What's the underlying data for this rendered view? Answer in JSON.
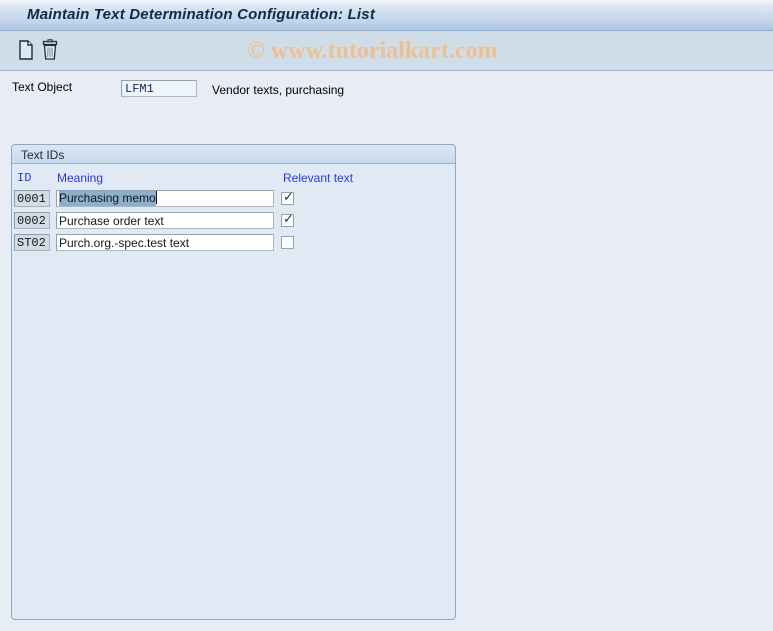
{
  "window": {
    "title": "Maintain Text Determination Configuration: List"
  },
  "watermark": {
    "text": "© www.tutorialkart.com",
    "color": "#edc093"
  },
  "toolbar": {
    "buttons": [
      {
        "icon": "new-document-icon",
        "tooltip": "New Entries"
      },
      {
        "icon": "delete-trash-icon",
        "tooltip": "Delete"
      }
    ]
  },
  "header_form": {
    "text_object_label": "Text Object",
    "text_object_value": "LFM1",
    "text_object_placeholder": "",
    "text_object_description": "Vendor texts, purchasing"
  },
  "panel": {
    "title": "Text IDs",
    "columns": {
      "id": "ID",
      "meaning": "Meaning",
      "relevant": "Relevant text"
    },
    "rows": [
      {
        "id": "0001",
        "meaning": "Purchasing memo",
        "meaning_selected": true,
        "relevant": true,
        "check_glyph": "✓"
      },
      {
        "id": "0002",
        "meaning": "Purchase order text",
        "meaning_selected": false,
        "relevant": true,
        "check_glyph": "✓"
      },
      {
        "id": "ST02",
        "meaning": "Purch.org.-spec.test text",
        "meaning_selected": false,
        "relevant": false,
        "check_glyph": ""
      }
    ]
  },
  "colors": {
    "page_background": "#e8edf5",
    "titlebar_gradient_top": "#f2f6fb",
    "titlebar_gradient_bottom": "#aec6e0",
    "toolbar_background": "#cfdde9",
    "panel_background": "#e1e9f4",
    "panel_border": "#8ba8c6",
    "column_header_text": "#2b38e0",
    "selection_highlight": "#8eaec9"
  }
}
